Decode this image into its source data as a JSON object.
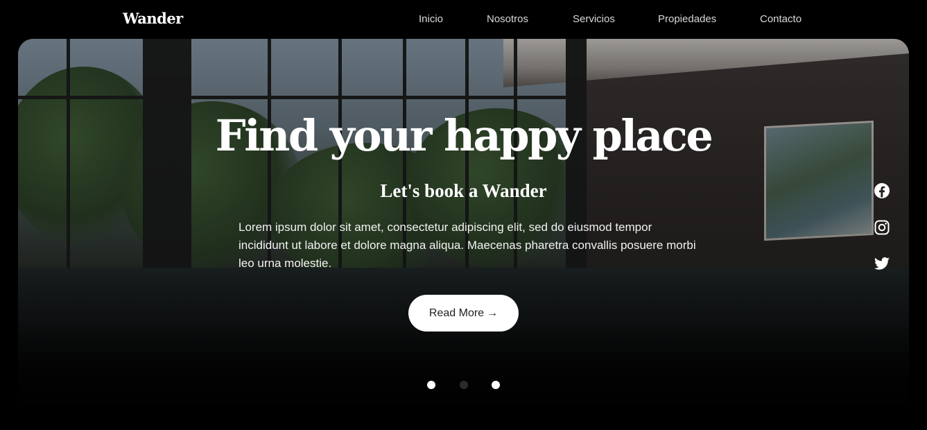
{
  "header": {
    "logo": "Wander",
    "nav": [
      {
        "label": "Inicio"
      },
      {
        "label": "Nosotros"
      },
      {
        "label": "Servicios"
      },
      {
        "label": "Propiedades"
      },
      {
        "label": "Contacto"
      }
    ]
  },
  "hero": {
    "title": "Find your happy place",
    "subtitle": "Let's book a Wander",
    "body": "Lorem ipsum dolor sit amet, consectetur adipiscing elit, sed do eiusmod tempor incididunt ut labore et dolore magna aliqua. Maecenas pharetra convallis posuere morbi leo urna molestie.",
    "cta_label": "Read More",
    "cta_arrow": "→",
    "socials": [
      {
        "icon": "facebook-icon"
      },
      {
        "icon": "instagram-icon"
      },
      {
        "icon": "twitter-icon"
      }
    ],
    "slider": {
      "slides": 3,
      "active": 2
    }
  },
  "colors": {
    "background": "#000000",
    "text": "#ffffff",
    "nav_text": "#d9d9d9",
    "cta_background": "#ffffff",
    "cta_text": "#1e1e1e",
    "dot_active": "#ffffff",
    "dot_inactive": "#2b2b2b"
  }
}
